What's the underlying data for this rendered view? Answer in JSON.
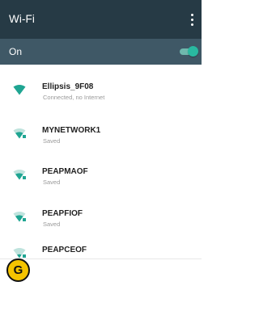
{
  "appbar": {
    "title": "Wi-Fi",
    "overflow_icon": "more-vert-icon",
    "background": "#263a45"
  },
  "wifi_toggle": {
    "label": "On",
    "state": "on",
    "background": "#3f5866",
    "accent": "#29b9a0"
  },
  "networks": [
    {
      "name": "Ellipsis_9F08",
      "status": "Connected, no Internet",
      "icon": "wifi-signal-icon"
    },
    {
      "name": "MYNETWORK1",
      "status": "Saved",
      "icon": "wifi-signal-icon"
    },
    {
      "name": "PEAPMAOF",
      "status": "Saved",
      "icon": "wifi-signal-icon"
    },
    {
      "name": "PEAPFIOF",
      "status": "Saved",
      "icon": "wifi-signal-icon"
    },
    {
      "name": "PEAPCEOF",
      "status": "",
      "icon": "wifi-signal-icon"
    }
  ],
  "callout": {
    "letter": "G",
    "color": "#f5c400"
  }
}
